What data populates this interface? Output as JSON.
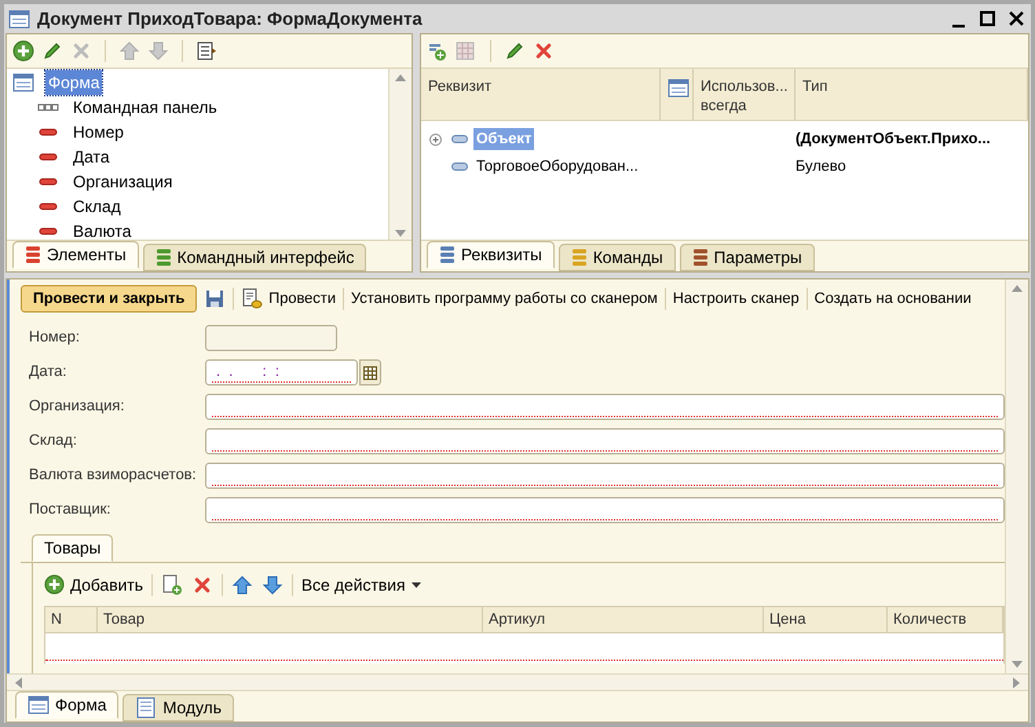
{
  "window": {
    "title": "Документ ПриходТовара: ФормаДокумента"
  },
  "elements_panel": {
    "tree": [
      {
        "label": "Форма",
        "selected": true,
        "children": [
          {
            "label": "Командная панель",
            "kind": "panel",
            "selected": false
          },
          {
            "label": "Номер",
            "kind": "field",
            "selected": false
          },
          {
            "label": "Дата",
            "kind": "field",
            "selected": false
          },
          {
            "label": "Организация",
            "kind": "field",
            "selected": false
          },
          {
            "label": "Склад",
            "kind": "field",
            "selected": false
          },
          {
            "label": "Валюта",
            "kind": "field",
            "selected": false
          }
        ]
      }
    ],
    "tabs": [
      {
        "label": "Элементы",
        "selected": true,
        "color": "#d9422f"
      },
      {
        "label": "Командный интерфейс",
        "selected": false,
        "color": "#4d9a2f"
      }
    ]
  },
  "attributes_panel": {
    "columns": [
      {
        "kind": "text",
        "label": "Реквизит"
      },
      {
        "kind": "icon"
      },
      {
        "kind": "text",
        "label": "Использов... всегда"
      },
      {
        "kind": "text",
        "label": "Тип"
      }
    ],
    "rows": [
      {
        "name": "Объект",
        "type": "(ДокументОбъект.Прихо...",
        "expandable": true,
        "selected": true
      },
      {
        "name": "ТорговоеОборудован...",
        "type": "Булево",
        "expandable": false,
        "selected": false
      }
    ],
    "tabs": [
      {
        "label": "Реквизиты",
        "selected": true,
        "color": "#5b7fb5"
      },
      {
        "label": "Команды",
        "selected": false,
        "color": "#d9a521"
      },
      {
        "label": "Параметры",
        "selected": false,
        "color": "#a0522d"
      }
    ]
  },
  "form": {
    "command_bar": [
      {
        "kind": "default",
        "label": "Провести и закрыть"
      },
      {
        "kind": "save"
      },
      {
        "kind": "post",
        "label": "Провести"
      },
      {
        "kind": "text",
        "label": "Установить программу работы со сканером"
      },
      {
        "kind": "text",
        "label": "Настроить сканер"
      },
      {
        "kind": "text",
        "label": "Создать на основании"
      }
    ],
    "fields": [
      {
        "label": "Номер:",
        "kind": "short",
        "required": false
      },
      {
        "label": "Дата:",
        "kind": "date",
        "value": " .  .       :  :",
        "required": true
      },
      {
        "label": "Организация:",
        "kind": "wide",
        "required": true
      },
      {
        "label": "Склад:",
        "kind": "wide",
        "required": true
      },
      {
        "label": "Валюта взиморасчетов:",
        "kind": "wide",
        "required": true
      },
      {
        "label": "Поставщик:",
        "kind": "wide",
        "required": true
      }
    ],
    "tabs": [
      {
        "label": "Товары",
        "selected": true
      }
    ],
    "table_toolbar": [
      {
        "kind": "add",
        "label": "Добавить"
      },
      {
        "kind": "copy"
      },
      {
        "kind": "delete"
      },
      {
        "kind": "up"
      },
      {
        "kind": "down"
      },
      {
        "kind": "menu",
        "label": "Все действия"
      }
    ],
    "table": {
      "columns": [
        "N",
        "Товар",
        "Артикул",
        "Цена",
        "Количеств"
      ]
    }
  },
  "bottom_tabs": [
    {
      "label": "Форма",
      "selected": true
    },
    {
      "label": "Модуль",
      "selected": false
    }
  ]
}
